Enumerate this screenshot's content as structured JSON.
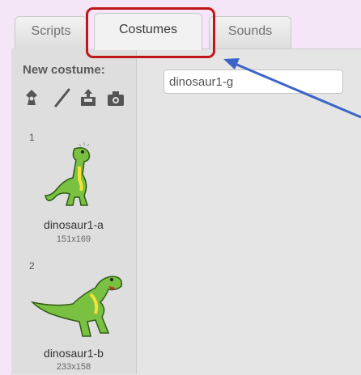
{
  "tabs": [
    {
      "label": "Scripts"
    },
    {
      "label": "Costumes",
      "active": true
    },
    {
      "label": "Sounds"
    }
  ],
  "sidebar": {
    "new_costume_label": "New costume:",
    "tools": [
      "paint-icon",
      "brush-icon",
      "upload-icon",
      "camera-icon"
    ]
  },
  "costume_name_value": "dinosaur1-g",
  "costumes": [
    {
      "number": "1",
      "name": "dinosaur1-a",
      "size": "151x169"
    },
    {
      "number": "2",
      "name": "dinosaur1-b",
      "size": "233x158"
    }
  ],
  "colors": {
    "highlight": "#c0161a",
    "arrow": "#3c64c8",
    "dino_green": "#7ac142"
  }
}
